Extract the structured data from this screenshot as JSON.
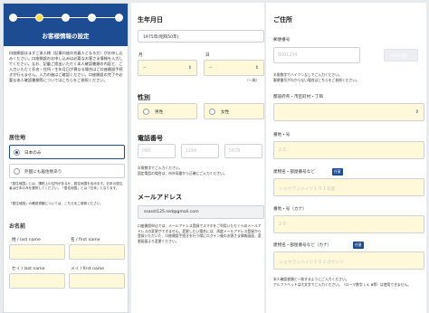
{
  "personal": {
    "title": "お客様情報の設定",
    "intro": "口座開設はまずご本人様（記事口座の名義人となる方）がお申し込みください。口座開設のお申し込みは必要なお客さま情報を入力してください。なお、記載ご提出いただく本人確認書類の内容と、ご入力いただく氏名・住所・生年月日が異なる場合はご口座開設手続きが行えません。入力の後はご確認ください。口座開設の完了や必要な本人確認書類等についてはこちらをご参照ください。",
    "residence_title": "居住地",
    "residence_opt1": "日本のみ",
    "residence_opt2": "外国にも居住地あり",
    "residence_note": "「居住地国」とは、課税上の住所があるか、居住地国を含みます。日本の居住者は日本のみを選択してください。「居住地国」とは「日本」となります。",
    "residence_note2": "「居住地国」の確認書類については、こちらをご参照ください。",
    "name_title": "お名前",
    "last_name_label": "姓 / last name",
    "first_name_label": "名 / first name",
    "last_kana_label": "セイ / last name",
    "first_kana_label": "メイ / first name"
  },
  "birth": {
    "title": "生年月日",
    "year_value": "1975年(昭和50年)",
    "month_label": "月",
    "day_label": "日",
    "month_value": "--",
    "day_value": "--",
    "note": "（一致）",
    "gender_title": "性別",
    "male": "男性",
    "female": "女性",
    "phone_title": "電話番号",
    "phone_ph1": "090",
    "phone_ph2": "1234",
    "phone_ph3": "5678",
    "phone_note": "半角数字でご入力ください。\n固定電話の場合は、市外局番から正確にご入力ください。",
    "email_title": "メールアドレス",
    "email_value": "ssasst125.red@gmail.com",
    "email_note": "口座開設申込では、メールアドレス登録でスマホをご利用いただくへのメールアドレスの変更ができません。変更したい場合には、再度メールアドレス登録から登録いただいた、口座開設手続きを行う際にログイン後のお客さま情報画面、変更画面より変更ください。"
  },
  "address": {
    "title": "ご住所",
    "postal_label": "郵便番号",
    "postal_ph": "0001234",
    "postal_button": "住所を検索",
    "postal_note": "半角数字でハイフンなしでご入力ください。\n郵便番号がわからない場合はこちらをご参照ください。",
    "pref_label": "都道府県・市区町村・丁目",
    "pref_value": "",
    "num_label": "番地・号",
    "num_ph": "2-3",
    "bldg_label": "建物名・部屋番号など",
    "bldg_badge": "任意",
    "bldg_ph": "ショウワンハイツ１０１号室",
    "num_kana_label": "番地・号（カナ）",
    "num_kana_ph": "2-3",
    "bldg_kana_label": "建物名・部屋番号など（カナ）",
    "bldg_kana_badge": "任意",
    "bldg_kana_ph": "ショウワンハイツ１０１ゴウシツ",
    "kana_note": "本人確認書類と一致するようにご入力ください。\nアルファベットは大文字でご入力ください。（ローマ数字 Ⅰ, Ⅱ, Ⅲ等）は使用できません。"
  }
}
